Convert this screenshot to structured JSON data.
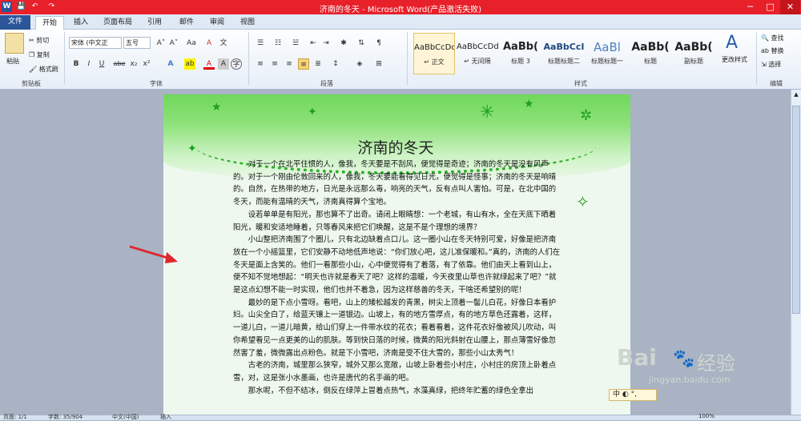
{
  "window": {
    "title": "济南的冬天 - Microsoft Word(产品激活失败)",
    "app_icon": "W",
    "min_label": "─",
    "max_label": "□",
    "close_label": "✕"
  },
  "quick_access": {
    "save": "💾",
    "undo": "↶",
    "redo": "↷"
  },
  "tabs": [
    "文件",
    "开始",
    "插入",
    "页面布局",
    "引用",
    "邮件",
    "审阅",
    "视图"
  ],
  "clipboard": {
    "paste": "粘贴",
    "cut": "剪切",
    "copy": "复制",
    "format_painter": "格式刷",
    "label": "剪贴板"
  },
  "font": {
    "name": "宋体 (中文正",
    "size": "五号",
    "grow": "A˄",
    "shrink": "A˅",
    "case": "Aa",
    "clear": "A",
    "bold": "B",
    "italic": "I",
    "underline": "U",
    "strike": "abe",
    "sub": "x₂",
    "sup": "x²",
    "effects": "A",
    "highlight": "ab",
    "color": "A",
    "char_shading": "A",
    "enclose": "字",
    "label": "字体"
  },
  "paragraph": {
    "label": "段落"
  },
  "styles": {
    "items": [
      {
        "preview": "AaBbCcDd",
        "name": "↵ 正文"
      },
      {
        "preview": "AaBbCcDd",
        "name": "↵ 无间隔"
      },
      {
        "preview": "AaBb(",
        "name": "标题 3"
      },
      {
        "preview": "AaBbCcI",
        "name": "标题标题二"
      },
      {
        "preview": "AaBl",
        "name": "标题标题一"
      },
      {
        "preview": "AaBb(",
        "name": "标题"
      },
      {
        "preview": "AaBb(",
        "name": "副标题"
      }
    ],
    "change": "更改样式",
    "label": "样式"
  },
  "editing": {
    "find": "查找",
    "replace": "替换",
    "select": "选择",
    "label": "编辑"
  },
  "document": {
    "title": "济南的冬天",
    "paragraphs": [
      "对于一个在北平住惯的人，像我，冬天要是不刮风，便觉得是奇迹；济南的冬天是没有风声的。对于一个刚由伦敦回来的人，像我，冬天要能看得见日光，便觉得是怪事；济南的冬天是响晴的。自然，在热带的地方，日光是永远那么毒，响亮的天气，反有点叫人害怕。可是，在北中国的冬天，而能有温晴的天气，济南真得算个宝地。",
      "设若单单是有阳光，那也算不了出奇。请闭上眼睛想：一个老城，有山有水，全在天底下晒着阳光，暖和安适地睡着，只等春风来把它们唤醒，这是不是个理想的境界？",
      "小山整把济南围了个圈儿，只有北边缺着点口儿。这一圈小山在冬天特别可爱，好像是把济南放在一个小摇篮里，它们安静不动地低声地说：“你们放心吧，这儿准保暖和。”真的，济南的人们在冬天是面上含笑的。他们一看那些小山，心中便觉得有了着落，有了依靠。他们由天上看到山上，便不知不觉地想起：“明天也许就是春天了吧？这样的温暖，今天夜里山草也许就绿起来了吧？”就是这点幻想不能一时实现，他们也并不着急，因为这样慈善的冬天，干啥还希望别的呢！",
      "最妙的是下点小雪呀。看吧，山上的矮松越发的青黑，树尖上顶着一髻儿白花，好像日本看护妇。山尖全白了，给蓝天镶上一道银边。山坡上，有的地方雪厚点，有的地方草色还露着，这样，一道儿白，一道儿暗黄，给山们穿上一件带水纹的花衣；看着看着，这件花衣好像被风儿吹动，叫你希望看见一点更美的山的肌肤。等到快日落的时候，微黄的阳光斜射在山腰上，那点薄雪好像忽然害了羞，微微露出点粉色。就是下小雪吧，济南是受不住大雪的，那些小山太秀气！",
      "古老的济南，城里那么狭窄，城外又那么宽敞，山坡上卧着些小村庄，小村庄的房顶上卧着点雪，对，这是张小水墨画，也许是唐代的名手画的吧。",
      "那水呢，不但不结冰，倒反在绿萍上冒着点热气，水藻真绿，把终年贮蓄的绿色全拿出"
    ]
  },
  "status": {
    "page": "页面: 1/1",
    "words": "字数: 35/904",
    "lang": "中文(中国)",
    "mode": "插入",
    "zoom": "100%"
  },
  "watermark": {
    "brand": "Bai",
    "brand2": "经验",
    "url": "jingyan.baidu.com",
    "ime": "中"
  }
}
